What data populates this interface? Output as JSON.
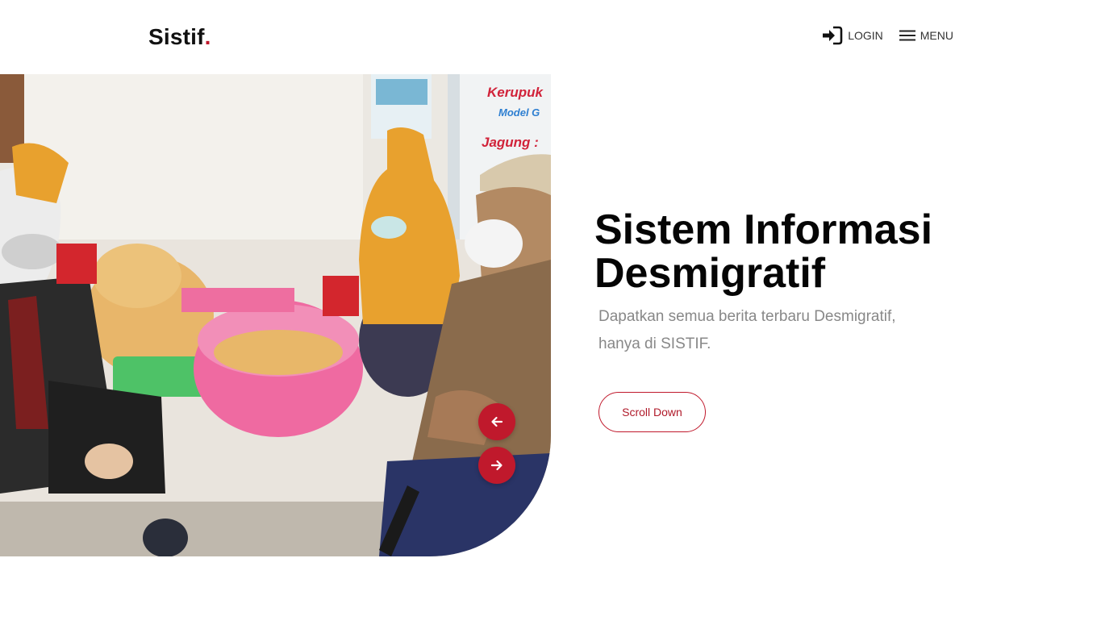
{
  "brand": {
    "name": "Sistif",
    "dot": "."
  },
  "nav": {
    "login_label": "LOGIN",
    "login_icon": "login-icon",
    "menu_label": "MENU",
    "menu_icon": "hamburger-icon"
  },
  "hero": {
    "title": "Sistem Informasi Desmigratif",
    "subtitle": "Dapatkan semua berita terbaru Desmigratif, hanya di SISTIF.",
    "cta_label": "Scroll Down",
    "prev_icon": "arrow-left-icon",
    "next_icon": "arrow-right-icon",
    "image_sign_text_1": "Kerupuk",
    "image_sign_text_2": "Model G",
    "image_sign_text_3": "Jagung :"
  },
  "colors": {
    "accent": "#c0192c",
    "title": "#050505",
    "subtitle": "#888888"
  }
}
